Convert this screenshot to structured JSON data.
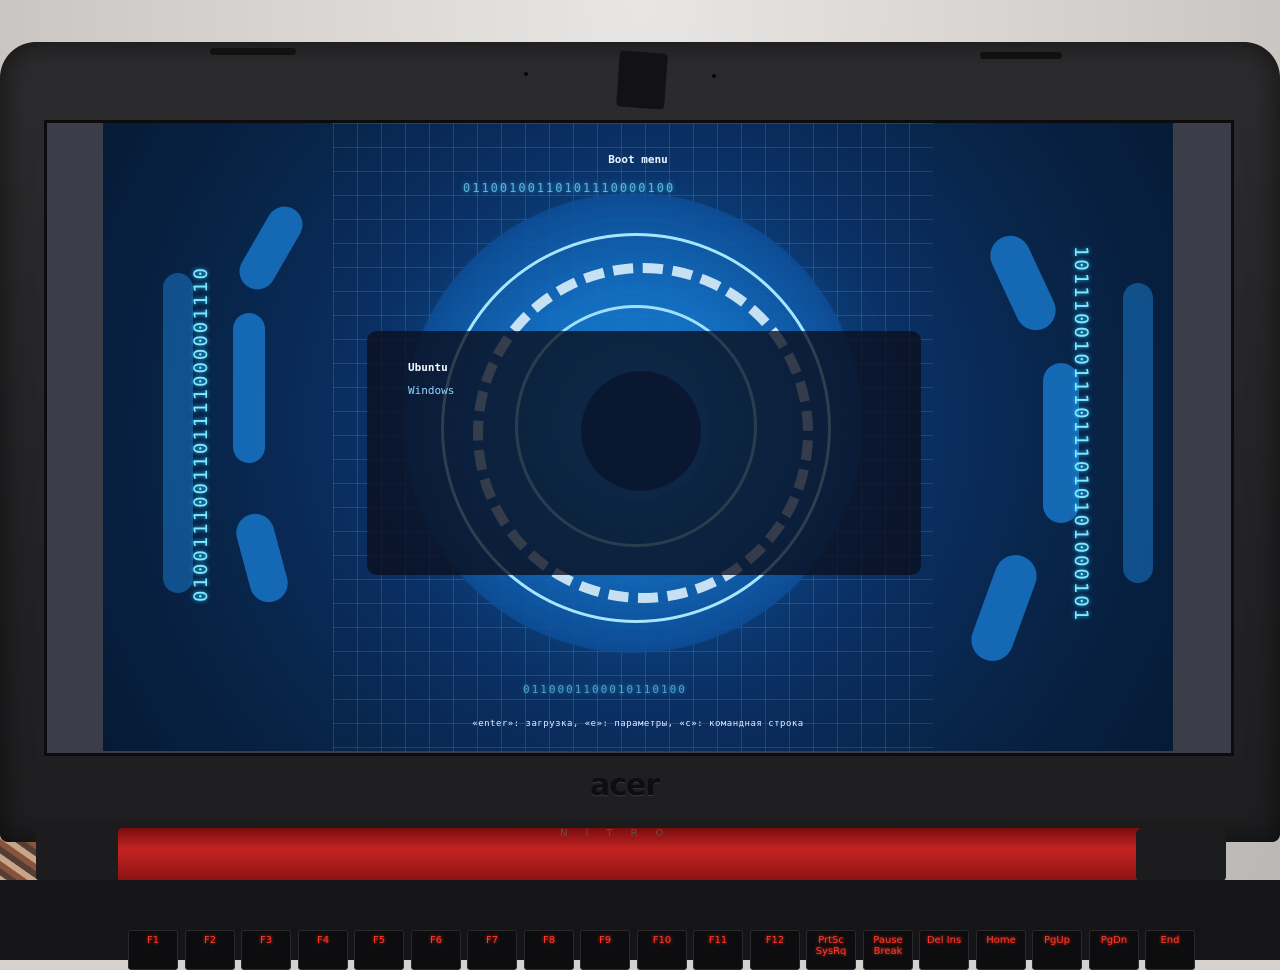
{
  "boot_menu": {
    "title": "Boot menu",
    "entries": [
      {
        "label": "Ubuntu",
        "selected": true
      },
      {
        "label": "Windows",
        "selected": false
      }
    ],
    "footer": "«enter»: загрузка, «e»: параметры, «c»: командная строка"
  },
  "decor": {
    "binary_left": "0100111001101111000001110",
    "binary_right": "1011100101110111010101000101",
    "binary_arc_top": "01100100110101110000100",
    "binary_arc_bottom": "0110001100010110100"
  },
  "laptop": {
    "brand": "acer",
    "model": "NITRO"
  },
  "keys": [
    "F1",
    "F2",
    "F3",
    "F4",
    "F5",
    "F6",
    "F7",
    "F8",
    "F9",
    "F10",
    "F11",
    "F12",
    "PrtSc SysRq",
    "Pause Break",
    "Del Ins",
    "Home",
    "PgUp",
    "PgDn",
    "End"
  ],
  "colors": {
    "accent": "#7fe9ff",
    "menu_selected": "#f2f6ff",
    "menu_unselected": "#8fd0ff",
    "deck_red": "#c42323"
  }
}
